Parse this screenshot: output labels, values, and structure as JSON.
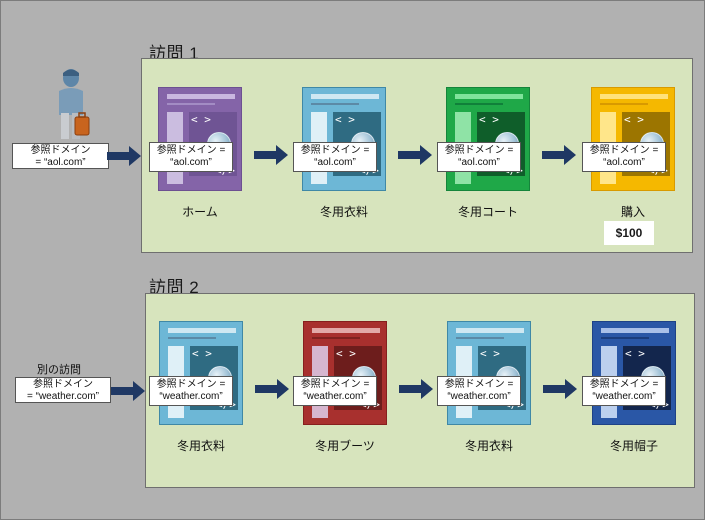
{
  "visit1": {
    "title": "訪問 1",
    "source_label": "参照ドメイン\n= “aol.com”",
    "pages": [
      {
        "label": "参照ドメイン =\n“aol.com”",
        "caption": "ホーム",
        "theme": "purple"
      },
      {
        "label": "参照ドメイン =\n“aol.com”",
        "caption": "冬用衣料",
        "theme": "teal"
      },
      {
        "label": "参照ドメイン =\n“aol.com”",
        "caption": "冬用コート",
        "theme": "green"
      },
      {
        "label": "参照ドメイン =\n“aol.com”",
        "caption": "購入",
        "theme": "gold"
      }
    ],
    "price": "$100"
  },
  "visit2": {
    "title": "訪問 2",
    "other_visit_label": "別の訪問",
    "source_label": "参照ドメイン\n= “weather.com”",
    "pages": [
      {
        "label": "参照ドメイン =\n“weather.com”",
        "caption": "冬用衣料",
        "theme": "teal"
      },
      {
        "label": "参照ドメイン =\n“weather.com”",
        "caption": "冬用ブーツ",
        "theme": "red"
      },
      {
        "label": "参照ドメイン =\n“weather.com”",
        "caption": "冬用衣料",
        "theme": "teal"
      },
      {
        "label": "参照ドメイン =\n“weather.com”",
        "caption": "冬用帽子",
        "theme": "blue"
      }
    ]
  },
  "colors": {
    "arrow": "#1f3864",
    "panel": "#d7e4bd",
    "background": "#b1b1b1"
  },
  "icons": {
    "visitor": "person-with-suitcase-icon",
    "page": "web-page-icon",
    "arrow": "right-arrow-icon"
  }
}
